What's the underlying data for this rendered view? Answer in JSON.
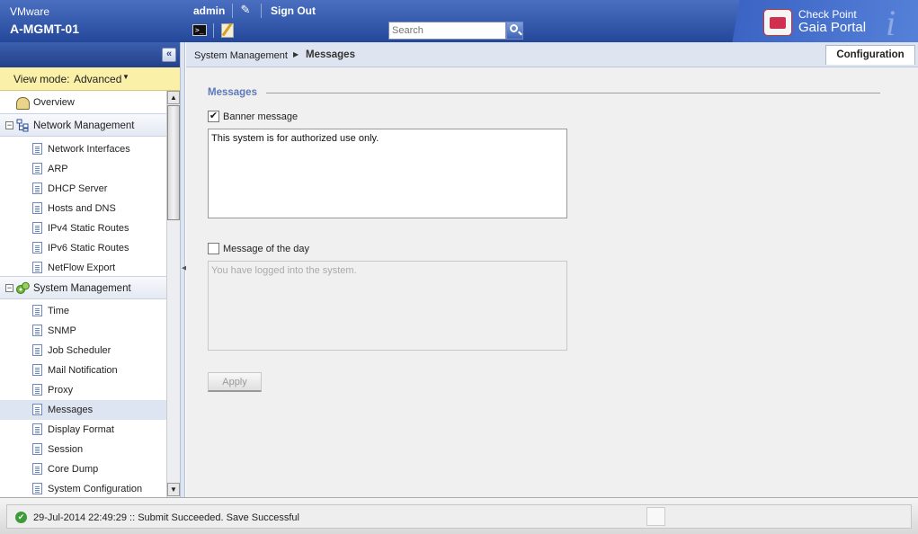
{
  "header": {
    "platform": "VMware",
    "hostname": "A-MGMT-01",
    "user": "admin",
    "signout_label": "Sign Out",
    "search_placeholder": "Search",
    "brand_vendor": "Check Point",
    "brand_product": "Gaia Portal"
  },
  "sidebar": {
    "viewmode_label": "View mode:",
    "viewmode_value": "Advanced",
    "overview": "Overview",
    "categories": [
      {
        "label": "Network Management",
        "items": [
          "Network Interfaces",
          "ARP",
          "DHCP Server",
          "Hosts and DNS",
          "IPv4 Static Routes",
          "IPv6 Static Routes",
          "NetFlow Export"
        ]
      },
      {
        "label": "System Management",
        "items": [
          "Time",
          "SNMP",
          "Job Scheduler",
          "Mail Notification",
          "Proxy",
          "Messages",
          "Display Format",
          "Session",
          "Core Dump",
          "System Configuration"
        ]
      }
    ],
    "selected_item": "Messages"
  },
  "breadcrumb": {
    "parent": "System Management",
    "current": "Messages"
  },
  "tabs": {
    "configuration": "Configuration"
  },
  "main": {
    "section_title": "Messages",
    "banner_label": "Banner message",
    "banner_checked": true,
    "banner_text": "This system is for authorized use only.",
    "motd_label": "Message of the day",
    "motd_checked": false,
    "motd_text": "You have logged into the system.",
    "apply_label": "Apply"
  },
  "status": {
    "text": "29-Jul-2014 22:49:29 :: Submit Succeeded. Save Successful"
  },
  "colors": {
    "header": "#24479a",
    "section_title": "#5d79b9",
    "viewmode_bg": "#fbf0a8",
    "selected_item_bg": "#dde4f2",
    "success": "#3d9b38"
  }
}
